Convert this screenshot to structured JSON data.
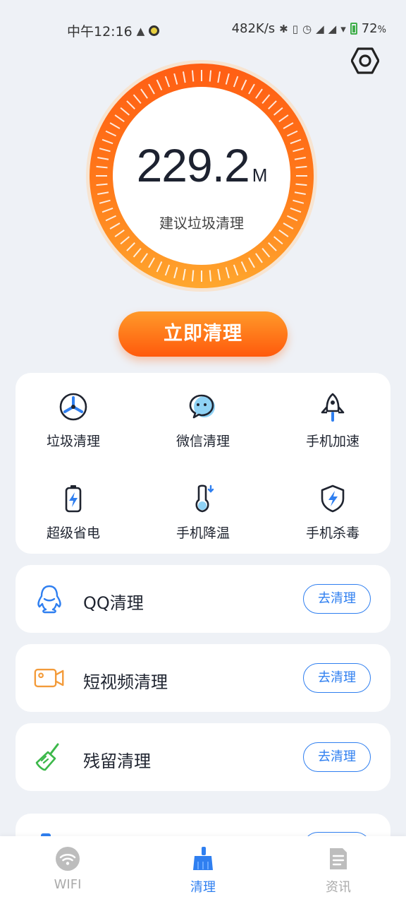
{
  "status_bar": {
    "time": "中午12:16",
    "net_speed": "482K/s",
    "battery": "72",
    "battery_unit": "%"
  },
  "gauge": {
    "value": "229.2",
    "unit": "M",
    "hint": "建议垃圾清理"
  },
  "clean_button": "立即清理",
  "tools": [
    {
      "label": "垃圾清理",
      "icon": "fan-icon"
    },
    {
      "label": "微信清理",
      "icon": "wechat-chat-icon"
    },
    {
      "label": "手机加速",
      "icon": "rocket-icon"
    },
    {
      "label": "超级省电",
      "icon": "battery-bolt-icon"
    },
    {
      "label": "手机降温",
      "icon": "thermometer-icon"
    },
    {
      "label": "手机杀毒",
      "icon": "shield-bolt-icon"
    }
  ],
  "list_items": [
    {
      "title": "QQ清理",
      "action": "去清理",
      "icon": "qq-penguin-icon"
    },
    {
      "title": "短视频清理",
      "action": "去清理",
      "icon": "video-camera-icon"
    },
    {
      "title": "残留清理",
      "action": "去清理",
      "icon": "broom-icon"
    }
  ],
  "bottom_nav": [
    {
      "label": "WIFI",
      "icon": "wifi-icon",
      "active": false
    },
    {
      "label": "清理",
      "icon": "broom-icon",
      "active": true
    },
    {
      "label": "资讯",
      "icon": "document-icon",
      "active": false
    }
  ],
  "colors": {
    "accent_blue": "#2f7ff0",
    "gauge_orange": "#ff7a1a",
    "button_orange": "#ff6a14"
  }
}
